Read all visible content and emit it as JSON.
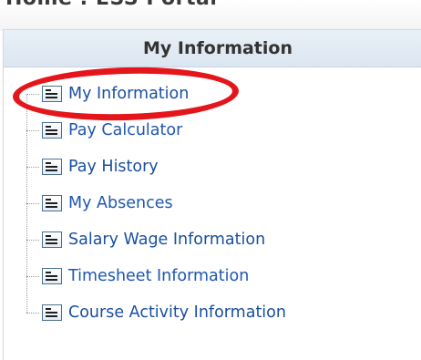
{
  "breadcrumb": "Home : ESS Portal",
  "panel": {
    "title": "My Information",
    "items": [
      {
        "label": "My Information",
        "icon": "document-list-icon"
      },
      {
        "label": "Pay Calculator",
        "icon": "document-list-icon"
      },
      {
        "label": "Pay History",
        "icon": "document-list-icon"
      },
      {
        "label": "My Absences",
        "icon": "document-list-icon"
      },
      {
        "label": "Salary Wage Information",
        "icon": "document-list-icon"
      },
      {
        "label": "Timesheet Information",
        "icon": "document-list-icon"
      },
      {
        "label": "Course Activity Information",
        "icon": "document-list-icon"
      }
    ]
  },
  "highlight": {
    "color": "#e4161b",
    "target": "My Information"
  },
  "colors": {
    "link": "#1e57b0",
    "header_bg": "#dbe6f1",
    "header_text": "#333333"
  }
}
